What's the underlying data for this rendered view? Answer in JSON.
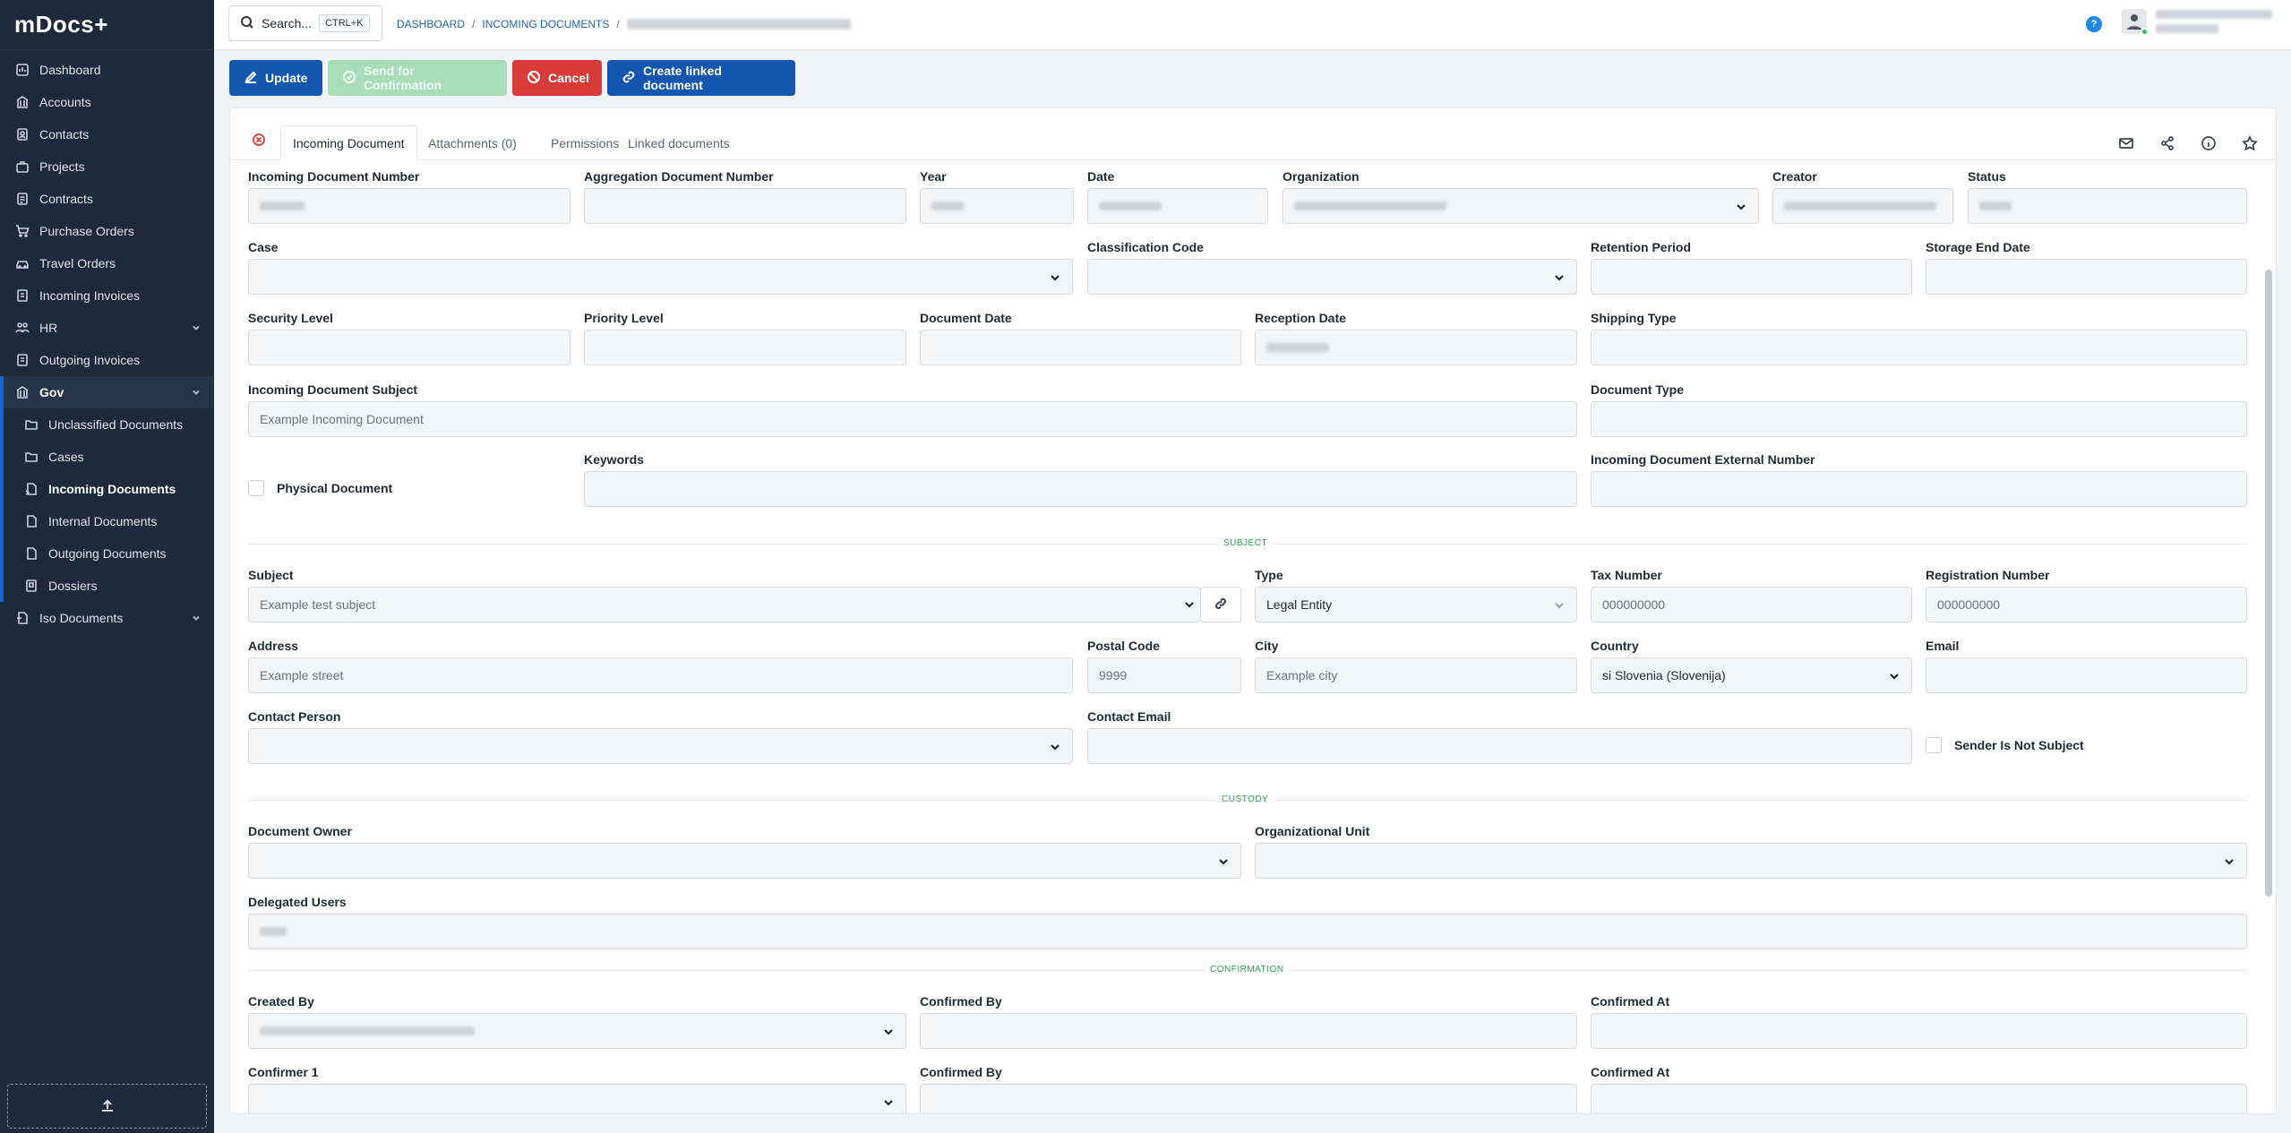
{
  "app": {
    "logo": "mDocs+"
  },
  "sidebar": {
    "items": [
      {
        "label": "Dashboard",
        "icon": "dashboard-icon"
      },
      {
        "label": "Accounts",
        "icon": "bank-icon"
      },
      {
        "label": "Contacts",
        "icon": "contacts-icon"
      },
      {
        "label": "Projects",
        "icon": "briefcase-icon"
      },
      {
        "label": "Contracts",
        "icon": "contract-icon"
      },
      {
        "label": "Purchase Orders",
        "icon": "cart-icon"
      },
      {
        "label": "Travel Orders",
        "icon": "car-icon"
      },
      {
        "label": "Incoming Invoices",
        "icon": "invoice-in-icon"
      },
      {
        "label": "HR",
        "icon": "people-icon"
      },
      {
        "label": "Outgoing Invoices",
        "icon": "invoice-out-icon"
      },
      {
        "label": "Gov",
        "icon": "gov-icon"
      }
    ],
    "gov_sub": [
      {
        "label": "Unclassified Documents"
      },
      {
        "label": "Cases"
      },
      {
        "label": "Incoming Documents"
      },
      {
        "label": "Internal Documents"
      },
      {
        "label": "Outgoing Documents"
      },
      {
        "label": "Dossiers"
      }
    ],
    "iso": {
      "label": "Iso Documents"
    }
  },
  "topbar": {
    "search_label": "Search...",
    "search_shortcut": "CTRL+K",
    "breadcrumb": [
      "DASHBOARD",
      "INCOMING DOCUMENTS"
    ],
    "help": "?"
  },
  "toolbar": {
    "update": "Update",
    "send": "Send for Confirmation",
    "cancel": "Cancel",
    "linked": "Create linked document"
  },
  "tabs": {
    "doc": "Incoming Document",
    "attachments": "Attachments (0)",
    "permissions": "Permissions",
    "linked": "Linked documents"
  },
  "form": {
    "row1": {
      "number": "Incoming Document Number",
      "aggregation": "Aggregation Document Number",
      "year": "Year",
      "date": "Date",
      "organization": "Organization",
      "creator": "Creator",
      "status": "Status"
    },
    "row2": {
      "case": "Case",
      "classification": "Classification Code",
      "retention": "Retention Period",
      "storage_end": "Storage End Date"
    },
    "row3": {
      "security": "Security Level",
      "priority": "Priority Level",
      "doc_date": "Document Date",
      "reception": "Reception Date",
      "shipping": "Shipping Type"
    },
    "row4": {
      "subject_lbl": "Incoming Document Subject",
      "subject_val": "Example Incoming Document",
      "doc_type": "Document Type"
    },
    "row5": {
      "physical": "Physical Document",
      "keywords": "Keywords",
      "external": "Incoming Document External Number"
    },
    "sections": {
      "subject": "SUBJECT",
      "custody": "CUSTODY",
      "confirmation": "CONFIRMATION"
    },
    "subject": {
      "subject_lbl": "Subject",
      "subject_val": "Example test subject",
      "type_lbl": "Type",
      "type_val": "Legal Entity",
      "tax_lbl": "Tax Number",
      "tax_ph": "000000000",
      "reg_lbl": "Registration Number",
      "reg_ph": "000000000",
      "address_lbl": "Address",
      "address_ph": "Example street",
      "postal_lbl": "Postal Code",
      "postal_ph": "9999",
      "city_lbl": "City",
      "city_ph": "Example city",
      "country_lbl": "Country",
      "country_val": "si Slovenia (Slovenija)",
      "email_lbl": "Email",
      "contact_person": "Contact Person",
      "contact_email": "Contact Email",
      "sender_not_subject": "Sender Is Not Subject"
    },
    "custody": {
      "owner": "Document Owner",
      "unit": "Organizational Unit",
      "delegated": "Delegated Users"
    },
    "confirmation": {
      "created_by": "Created By",
      "confirmed_by": "Confirmed By",
      "confirmed_at": "Confirmed At",
      "confirmer1": "Confirmer 1",
      "confirmed_by2": "Confirmed By",
      "confirmed_at2": "Confirmed At"
    }
  }
}
